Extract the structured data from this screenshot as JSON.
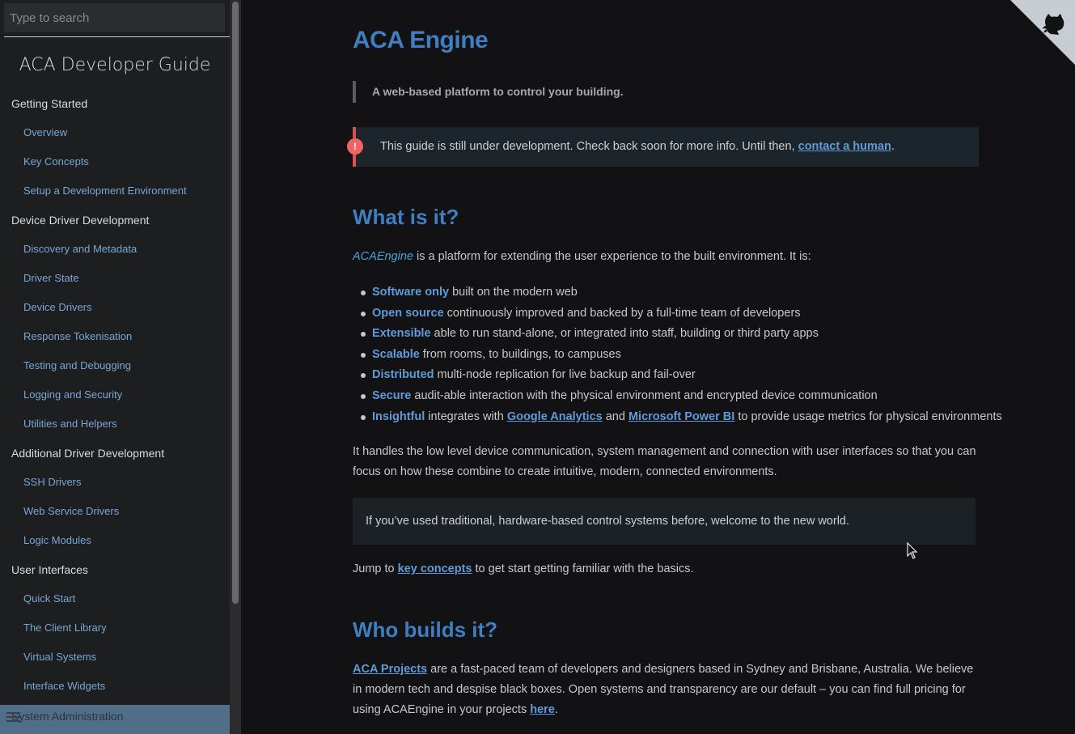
{
  "sidebar": {
    "search_placeholder": "Type to search",
    "app_title": "ACA Developer Guide",
    "items": [
      {
        "label": "Getting Started",
        "level": "section"
      },
      {
        "label": "Overview",
        "level": "sub"
      },
      {
        "label": "Key Concepts",
        "level": "sub"
      },
      {
        "label": "Setup a Development Environment",
        "level": "sub"
      },
      {
        "label": "Device Driver Development",
        "level": "section"
      },
      {
        "label": "Discovery and Metadata",
        "level": "sub"
      },
      {
        "label": "Driver State",
        "level": "sub"
      },
      {
        "label": "Device Drivers",
        "level": "sub"
      },
      {
        "label": "Response Tokenisation",
        "level": "sub"
      },
      {
        "label": "Testing and Debugging",
        "level": "sub"
      },
      {
        "label": "Logging and Security",
        "level": "sub"
      },
      {
        "label": "Utilities and Helpers",
        "level": "sub"
      },
      {
        "label": "Additional Driver Development",
        "level": "section"
      },
      {
        "label": "SSH Drivers",
        "level": "sub"
      },
      {
        "label": "Web Service Drivers",
        "level": "sub"
      },
      {
        "label": "Logic Modules",
        "level": "sub"
      },
      {
        "label": "User Interfaces",
        "level": "section"
      },
      {
        "label": "Quick Start",
        "level": "sub"
      },
      {
        "label": "The Client Library",
        "level": "sub"
      },
      {
        "label": "Virtual Systems",
        "level": "sub"
      },
      {
        "label": "Interface Widgets",
        "level": "sub"
      }
    ],
    "bottom_item": "System Administration"
  },
  "content": {
    "title": "ACA Engine",
    "lead": "A web-based platform to control your building.",
    "warning": {
      "text": "This guide is still under development. Check back soon for more info. Until then, ",
      "link": "contact a human",
      "suffix": "."
    },
    "h2_what": "What is it?",
    "intro": {
      "brand": "ACAEngine",
      "text": " is a platform for extending the user experience to the built environment. It is:"
    },
    "features": [
      {
        "kw": "Software only",
        "text": " built on the modern web"
      },
      {
        "kw": "Open source",
        "text": " continuously improved and backed by a full-time team of developers"
      },
      {
        "kw": "Extensible",
        "text": " able to run stand-alone, or integrated into staff, building or third party apps"
      },
      {
        "kw": "Scalable",
        "text": " from rooms, to buildings, to campuses"
      },
      {
        "kw": "Distributed",
        "text": " multi-node replication for live backup and fail-over"
      },
      {
        "kw": "Secure",
        "text": " audit-able interaction with the physical environment and encrypted device communication"
      }
    ],
    "insightful": {
      "kw": "Insightful",
      "text1": " integrates with ",
      "link1": "Google Analytics",
      "text2": " and ",
      "link2": "Microsoft Power BI",
      "text3": " to provide usage metrics for physical environments"
    },
    "handles": "It handles the low level device communication, system management and connection with user interfaces so that you can focus on how these combine to create intuitive, modern, connected environments.",
    "note": "If you’ve used traditional, hardware-based control systems before, welcome to the new world.",
    "jump": {
      "text1": "Jump to ",
      "link": "key concepts",
      "text2": " to get start getting familiar with the basics."
    },
    "h2_who": "Who builds it?",
    "who": {
      "link1": "ACA Projects",
      "text1": " are a fast-paced team of developers and designers based in Sydney and Brisbane, Australia. We believe in modern tech and despise black boxes. Open systems and transparency are our default – you can find full pricing for using ACAEngine in your projects ",
      "link2": "here",
      "text2": "."
    }
  },
  "colors": {
    "accent": "#3f7ec0",
    "link": "#5f9bd8",
    "warning": "#f06464"
  },
  "icons": {
    "corner": "github-octocat-icon",
    "menu": "hamburger-icon"
  }
}
